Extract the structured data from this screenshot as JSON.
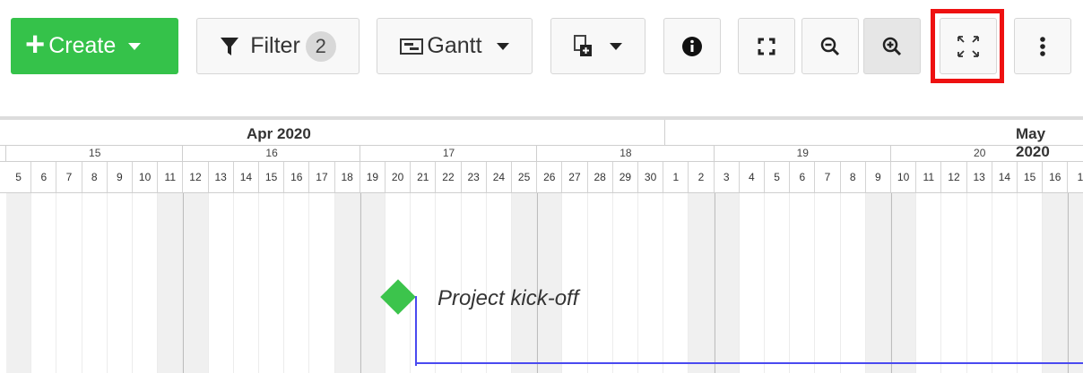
{
  "toolbar": {
    "create_label": "Create",
    "filter_label": "Filter",
    "filter_count": "2",
    "view_label": "Gantt",
    "icons": {
      "create": "plus-icon",
      "filter": "filter-icon",
      "gantt": "gantt-view-icon",
      "export": "export-icon",
      "info": "info-icon",
      "fit": "fit-to-screen-icon",
      "zoom_out": "zoom-out-icon",
      "zoom_in": "zoom-in-icon",
      "fullscreen": "fullscreen-icon",
      "more": "more-vertical-icon"
    },
    "colors": {
      "create_bg": "#35c24a",
      "highlight": "#ee1111"
    }
  },
  "gantt": {
    "months": [
      "Apr 2020",
      "May 2020"
    ],
    "weeks": [
      "15",
      "16",
      "17",
      "18",
      "19",
      "20"
    ],
    "days": [
      "5",
      "6",
      "7",
      "8",
      "9",
      "10",
      "11",
      "12",
      "13",
      "14",
      "15",
      "16",
      "17",
      "18",
      "19",
      "20",
      "21",
      "22",
      "23",
      "24",
      "25",
      "26",
      "27",
      "28",
      "29",
      "30",
      "1",
      "2",
      "3",
      "4",
      "5",
      "6",
      "7",
      "8",
      "9",
      "10",
      "11",
      "12",
      "13",
      "14",
      "15",
      "16",
      "1"
    ],
    "milestone": {
      "label": "Project kick-off",
      "color": "#3cc44c"
    },
    "dependency_color": "#4a4af0"
  }
}
